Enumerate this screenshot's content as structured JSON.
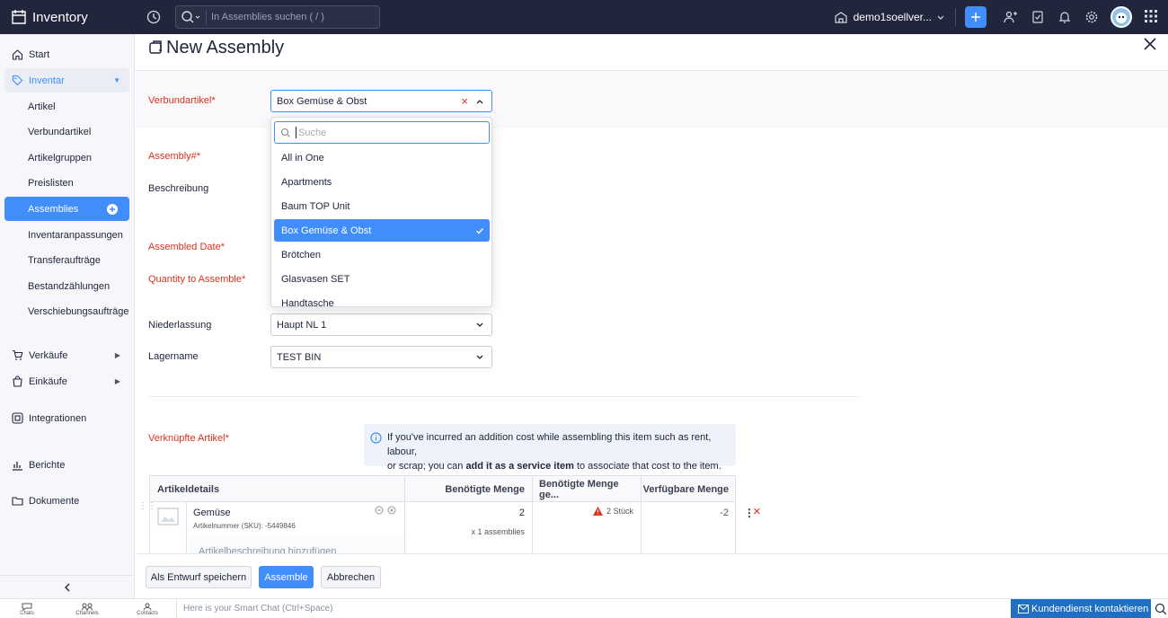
{
  "app": {
    "title": "Inventory"
  },
  "topbar": {
    "search_placeholder": "In Assemblies suchen ( / )",
    "org_name": "demo1soellver..."
  },
  "sidebar": {
    "start": "Start",
    "inventar": "Inventar",
    "sub": [
      "Artikel",
      "Verbundartikel",
      "Artikelgruppen",
      "Preislisten",
      "Assemblies",
      "Inventaranpassungen",
      "Transferaufträge",
      "Bestandzählungen",
      "Verschiebungsaufträge"
    ],
    "verkaeufe": "Verkäufe",
    "einkaeufe": "Einkäufe",
    "integrationen": "Integrationen",
    "berichte": "Berichte",
    "dokumente": "Dokumente"
  },
  "page": {
    "title": "New Assembly"
  },
  "form": {
    "verbundartikel_label": "Verbundartikel*",
    "verbundartikel_value": "Box Gemüse & Obst",
    "assembly_no_label": "Assembly#*",
    "beschreibung_label": "Beschreibung",
    "assembled_date_label": "Assembled Date*",
    "quantity_label": "Quantity to Assemble*",
    "niederlassung_label": "Niederlassung",
    "niederlassung_value": "Haupt NL 1",
    "lagername_label": "Lagername",
    "lagername_value": "TEST BIN",
    "verknuepfte_label": "Verknüpfte Artikel*"
  },
  "dropdown": {
    "search_placeholder": "Suche",
    "options": [
      "All in One",
      "Apartments",
      "Baum TOP Unit",
      "Box Gemüse & Obst",
      "Brötchen",
      "Glasvasen SET",
      "Handtasche"
    ],
    "selected": "Box Gemüse & Obst"
  },
  "info": {
    "text1": "If you've incurred an addition cost while assembling this item such as rent, labour,",
    "text2_pre": "or scrap; you can ",
    "text2_bold": "add it as a service item",
    "text2_post": " to associate that cost to the item."
  },
  "table": {
    "headers": [
      "Artikeldetails",
      "Benötigte Menge",
      "Benötigte Menge ge...",
      "Verfügbare Menge"
    ],
    "row": {
      "name": "Gemüse",
      "sku": "Artikelnummer (SKU): -5449846",
      "qty": "2",
      "qty_sub": "x 1 assemblies",
      "warn": "2 Stück",
      "available": "-2",
      "desc_placeholder": "Artikelbeschreibung hinzufügen"
    }
  },
  "actions": {
    "draft": "Als Entwurf speichern",
    "assemble": "Assemble",
    "cancel": "Abbrechen"
  },
  "bottombar": {
    "chats": "Chats",
    "channels": "Channels",
    "contacts": "Contacts",
    "chat_placeholder": "Here is your Smart Chat (Ctrl+Space)",
    "support": "Kundendienst kontaktieren"
  },
  "colors": {
    "primary": "#408dfb",
    "dark": "#21263c",
    "required": "#d6341f"
  }
}
